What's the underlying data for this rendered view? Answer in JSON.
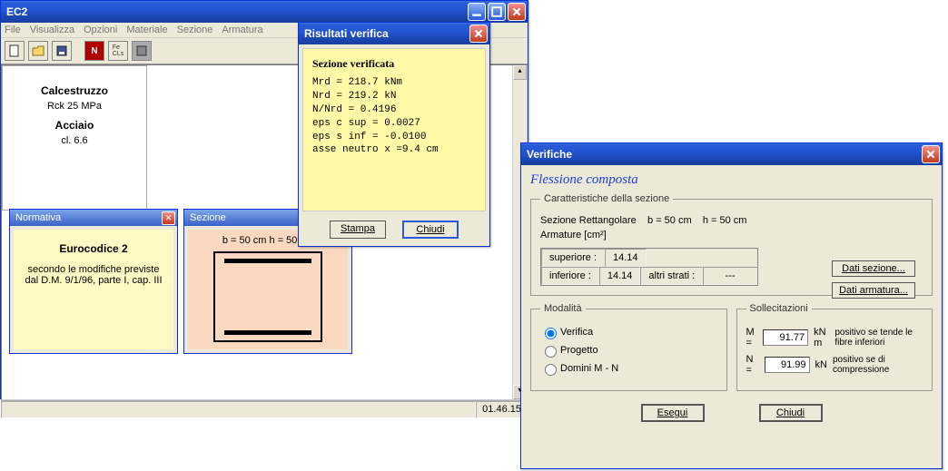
{
  "main": {
    "title": "EC2",
    "menu": [
      "File",
      "Visualizza",
      "Opzioni",
      "Materiale",
      "Sezione",
      "Armatura"
    ],
    "toolbar": [
      "new",
      "open",
      "save",
      "n-icon",
      "fe-cls",
      "grey"
    ],
    "statusbar_time": "01.46.15"
  },
  "normativa": {
    "title": "Normativa",
    "heading": "Eurocodice 2",
    "body": "secondo le modifiche previste dal D.M. 9/1/96, parte I, cap. III"
  },
  "sezione_panel": {
    "title": "Sezione",
    "dims": "b = 50 cm    h = 50 cm"
  },
  "materiali": {
    "calc_hdr": "Calcestruzzo",
    "calc_val": "Rck   25 MPa",
    "acc_hdr": "Acciaio",
    "acc_val": "cl. 6.6"
  },
  "risultati": {
    "title": "Risultati verifica",
    "header": "Sezione verificata",
    "lines": [
      "Mrd =  218.7 kNm",
      "Nrd =  219.2 kN",
      "N/Nrd =  0.4196",
      "",
      "eps c sup =  0.0027",
      "eps s inf = -0.0100",
      "asse neutro x =9.4 cm"
    ],
    "btn_stampa": "Stampa",
    "btn_chiudi": "Chiudi"
  },
  "verifiche": {
    "title": "Verifiche",
    "heading": "Flessione composta",
    "caratt_legend": "Caratteristiche della sezione",
    "sezione_line": "Sezione Rettangolare    b = 50 cm    h = 50 cm",
    "armature_label": "Armature  [cm²]",
    "arm_sup_label": "superiore :",
    "arm_sup_val": "14.14",
    "arm_inf_label": "inferiore :",
    "arm_inf_val": "14.14",
    "arm_altri_label": "altri strati :",
    "arm_altri_val": "---",
    "btn_dati_sezione": "Dati sezione...",
    "btn_dati_armatura": "Dati armatura...",
    "modalita_legend": "Modalità",
    "modalita_opts": [
      "Verifica",
      "Progetto",
      "Domini M - N"
    ],
    "solle_legend": "Sollecitazioni",
    "M_label": "M  =",
    "M_val": "91.77",
    "M_unit": "kN m",
    "M_note": "positivo se tende le fibre  inferiori",
    "N_label": "N  =",
    "N_val": "91.99",
    "N_unit": "kN",
    "N_note": "positivo  se di compressione",
    "btn_esegui": "Esegui",
    "btn_chiudi": "Chiudi"
  },
  "chart_data": {
    "type": "table",
    "title": "Risultati verifica — Sezione verificata",
    "rows": [
      {
        "label": "Mrd",
        "value": 218.7,
        "unit": "kNm"
      },
      {
        "label": "Nrd",
        "value": 219.2,
        "unit": "kN"
      },
      {
        "label": "N/Nrd",
        "value": 0.4196,
        "unit": ""
      },
      {
        "label": "eps c sup",
        "value": 0.0027,
        "unit": ""
      },
      {
        "label": "eps s inf",
        "value": -0.01,
        "unit": ""
      },
      {
        "label": "asse neutro x",
        "value": 9.4,
        "unit": "cm"
      }
    ]
  }
}
